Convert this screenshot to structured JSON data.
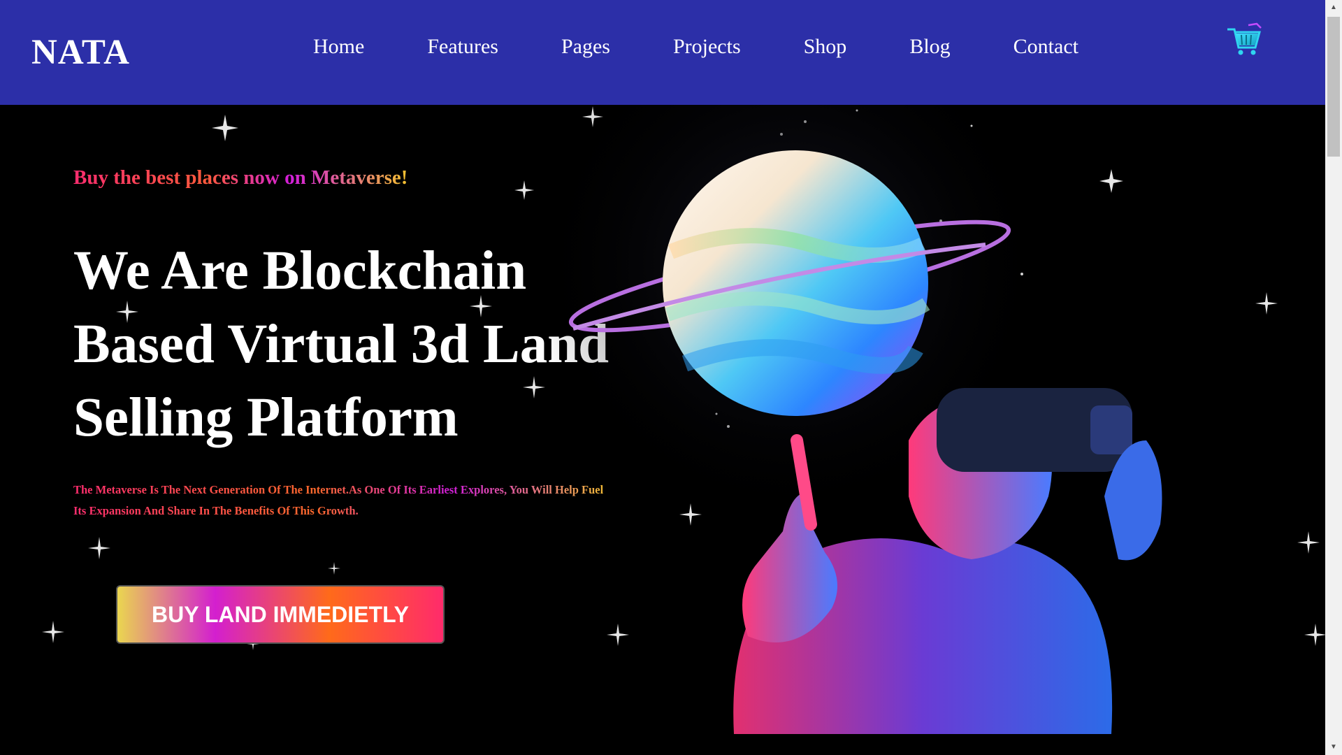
{
  "header": {
    "logo": "NATA",
    "nav": [
      "Home",
      "Features",
      "Pages",
      "Projects",
      "Shop",
      "Blog",
      "Contact"
    ],
    "cart_icon": "shopping-cart-icon"
  },
  "hero": {
    "tagline": "Buy the best places now on Metaverse!",
    "headline_lines": [
      "We Are Blockchain",
      "Based Virtual 3d Land",
      "Selling Platform"
    ],
    "description": "The Metaverse Is The Next Generation Of The Internet.As One Of Its Earliest Explores, You Will Help Fuel Its Expansion And Share In The Benefits Of This Growth.",
    "cta_label": "BUY LAND IMMEDIETLY"
  },
  "colors": {
    "navbar_bg": "#2c2fa8",
    "hero_bg": "#000000",
    "accent_pink": "#ff2d6f",
    "accent_purple": "#d21edb",
    "accent_yellow": "#f3c12e"
  }
}
